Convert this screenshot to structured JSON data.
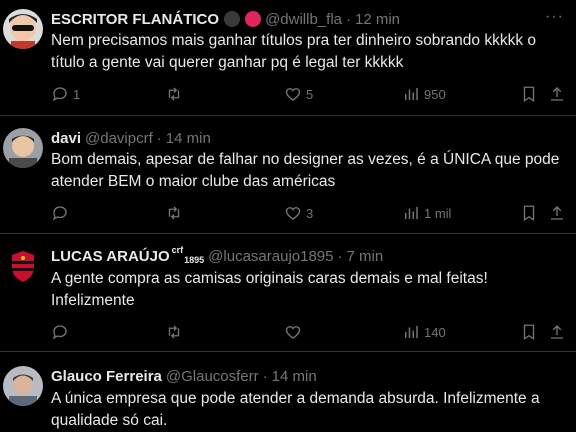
{
  "tweets": [
    {
      "name": "ESCRITOR FLANÁTICO",
      "handle": "@dwillb_fla",
      "dot": "·",
      "time": "12 min",
      "text_lines": [
        "Nem precisamos mais ganhar títulos pra ter dinheiro sobrando kkkkk o",
        "título a gente vai querer ganhar pq é legal ter kkkkk"
      ],
      "replies": "1",
      "retweets": "",
      "likes": "5",
      "views": "950"
    },
    {
      "name": "davi",
      "handle": "@davipcrf",
      "dot": "·",
      "time": "14 min",
      "text_lines": [
        "Bom demais, apesar de falhar no designer as vezes, é a ÚNICA que pode",
        "atender BEM o maior clube das américas"
      ],
      "replies": "",
      "retweets": "",
      "likes": "3",
      "views": "1 mil"
    },
    {
      "name": "LUCAS ARAÚJO",
      "name_sup": "crf",
      "name_sub": "1895",
      "handle": "@lucasaraujo1895",
      "dot": "·",
      "time": "7 min",
      "text_lines": [
        "A gente compra as camisas originais caras demais e mal feitas!",
        "Infelizmente"
      ],
      "replies": "",
      "retweets": "",
      "likes": "",
      "views": "140"
    },
    {
      "name": "Glauco Ferreira",
      "handle": "@Glaucosferr",
      "dot": "·",
      "time": "14 min",
      "text_lines": [
        "A única empresa que pode atender a demanda absurda. Infelizmente a",
        "qualidade só cai."
      ]
    }
  ],
  "more_glyph": "···",
  "colors": {
    "background": "#000000",
    "text": "#e7e9ea",
    "muted": "#71767b",
    "divider": "#2f3336",
    "badge_red": "#e0245e",
    "badge_gray": "#3a3a3a"
  }
}
